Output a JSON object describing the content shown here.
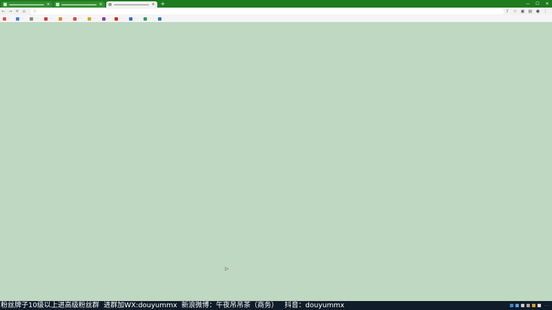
{
  "tabs": [
    {
      "close_glyph": "✕",
      "active": false
    },
    {
      "close_glyph": "✕",
      "active": false
    },
    {
      "close_glyph": "✕",
      "active": true
    }
  ],
  "new_tab_glyph": "+",
  "window_controls": {
    "minimize": "—",
    "maximize": "☐",
    "close": "✕"
  },
  "nav": {
    "back": "←",
    "forward": "→",
    "reload": "✕",
    "home": "⌂"
  },
  "address": {
    "lock_glyph": "ⓘ",
    "text": "···"
  },
  "toolbar_icons": {
    "share": "⇪",
    "star": "☆",
    "reading": "▣",
    "extensions": "▤",
    "profile": "●",
    "menu": "⋮"
  },
  "bookmarks": [
    {
      "label": "··",
      "color": "#e05555"
    },
    {
      "label": "···",
      "color": "#4a7fd1"
    },
    {
      "label": "···",
      "color": "#888888"
    },
    {
      "label": "···",
      "color": "#d04040"
    },
    {
      "label": "···",
      "color": "#e08a30"
    },
    {
      "label": "···",
      "color": "#d94a4a"
    },
    {
      "label": "···",
      "color": "#e0a020"
    },
    {
      "label": "··",
      "color": "#8e3fb0"
    },
    {
      "label": "···",
      "color": "#d03030"
    },
    {
      "label": "···",
      "color": "#3a6fd0"
    },
    {
      "label": "···",
      "color": "#2fa060"
    },
    {
      "label": "··",
      "color": "#3a6fd0"
    }
  ],
  "cursor_glyph": "▷",
  "marquee_text": "粉丝牌子10级以上进高级粉丝群  进群加WX:douyummx  新浪微博：午夜吊吊茶（商务）   抖音：douyummx",
  "tray_icons": [
    "#3a8ad0",
    "#5aa0e0",
    "#cccccc",
    "#aaaaaa",
    "#e0a020",
    "#dddddd"
  ],
  "tray_clock": "···"
}
